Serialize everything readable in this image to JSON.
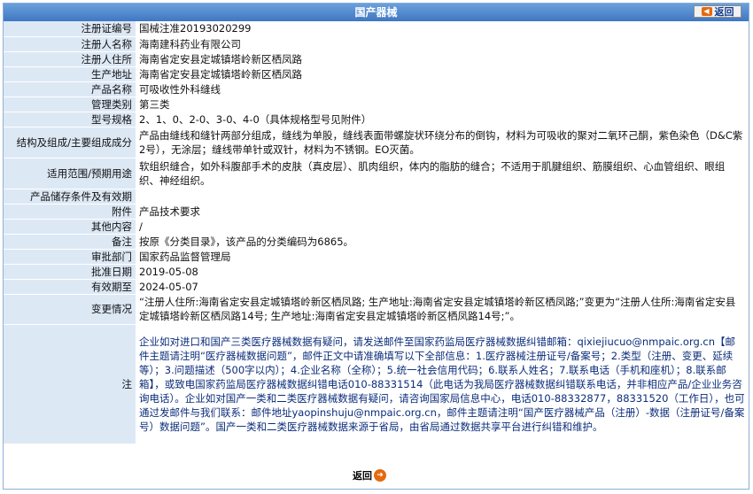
{
  "window": {
    "title": "国产器械",
    "back_label": "返回"
  },
  "rows": [
    {
      "label": "注册证编号",
      "value": "国械注准20193020299"
    },
    {
      "label": "注册人名称",
      "value": "海南建科药业有限公司"
    },
    {
      "label": "注册人住所",
      "value": "海南省定安县定城镇塔岭新区栖凤路"
    },
    {
      "label": "生产地址",
      "value": "海南省定安县定城镇塔岭新区栖凤路"
    },
    {
      "label": "产品名称",
      "value": "可吸收性外科缝线"
    },
    {
      "label": "管理类别",
      "value": "第三类"
    },
    {
      "label": "型号规格",
      "value": "2、1、0、2-0、3-0、4-0（具体规格型号见附件）"
    },
    {
      "label": "结构及组成/主要组成成分",
      "value": "产品由缝线和缝针两部分组成，缝线为单股，缝线表面带螺旋状环绕分布的倒钩，材料为可吸收的聚对二氧环己酮，紫色染色（D&C紫2号），无涂层；缝线带单针或双针，材料为不锈钢。EO灭菌。"
    },
    {
      "label": "适用范围/预期用途",
      "value": "软组织缝合，如外科腹部手术的皮肤（真皮层）、肌肉组织，体内的脂肪的缝合；不适用于肌腱组织、筋膜组织、心血管组织、眼组织、神经组织。"
    },
    {
      "label": "产品储存条件及有效期",
      "value": ""
    },
    {
      "label": "附件",
      "value": "产品技术要求"
    },
    {
      "label": "其他内容",
      "value": "/"
    },
    {
      "label": "备注",
      "value": "按原《分类目录》，该产品的分类编码为6865。"
    },
    {
      "label": "审批部门",
      "value": "国家药品监督管理局"
    },
    {
      "label": "批准日期",
      "value": "2019-05-08"
    },
    {
      "label": "有效期至",
      "value": "2024-05-07"
    },
    {
      "label": "变更情况",
      "value": "“注册人住所:海南省定安县定城镇塔岭新区栖凤路; 生产地址:海南省定安县定城镇塔岭新区栖凤路;”变更为“注册人住所:海南省定安县定城镇塔岭新区栖凤路14号; 生产地址:海南省定安县定城镇塔岭新区栖凤路14号;”。"
    },
    {
      "label": "注",
      "value": "企业如对进口和国产三类医疗器械数据有疑问，请发送邮件至国家药监局医疗器械数据纠错邮箱：qixiejiucuo@nmpaic.org.cn【邮件主题请注明“医疗器械数据问题”，邮件正文中请准确填写以下全部信息：1.医疗器械注册证号/备案号；2.类型（注册、变更、延续等）；3.问题描述（500字以内）；4.企业名称（全称）；5.统一社会信用代码；6.联系人姓名；7.联系电话（手机和座机）；8.联系邮箱】，或致电国家药监局医疗器械数据纠错电话010-88331514（此电话为我局医疗器械数据纠错联系电话，并非相应产品/企业业务咨询电话）。企业如对国产一类和二类医疗器械数据有疑问，请咨询国家局信息中心，电话010-88332877，88331520（工作日），也可通过发邮件与我们联系：邮件地址yaopinshuju@nmpaic.org.cn，邮件主题请注明“国产医疗器械产品（注册）-数据（注册证号/备案号）数据问题”。国产一类和二类医疗器械数据来源于省局，由省局通过数据共享平台进行纠错和维护。"
    }
  ],
  "icons": {
    "back": "back-arrow-icon"
  },
  "colors": {
    "label_bg": "#dde8f5",
    "title_bg": "#3f77c2",
    "note_text": "#0b2d7a",
    "accent": "#e46a10"
  }
}
